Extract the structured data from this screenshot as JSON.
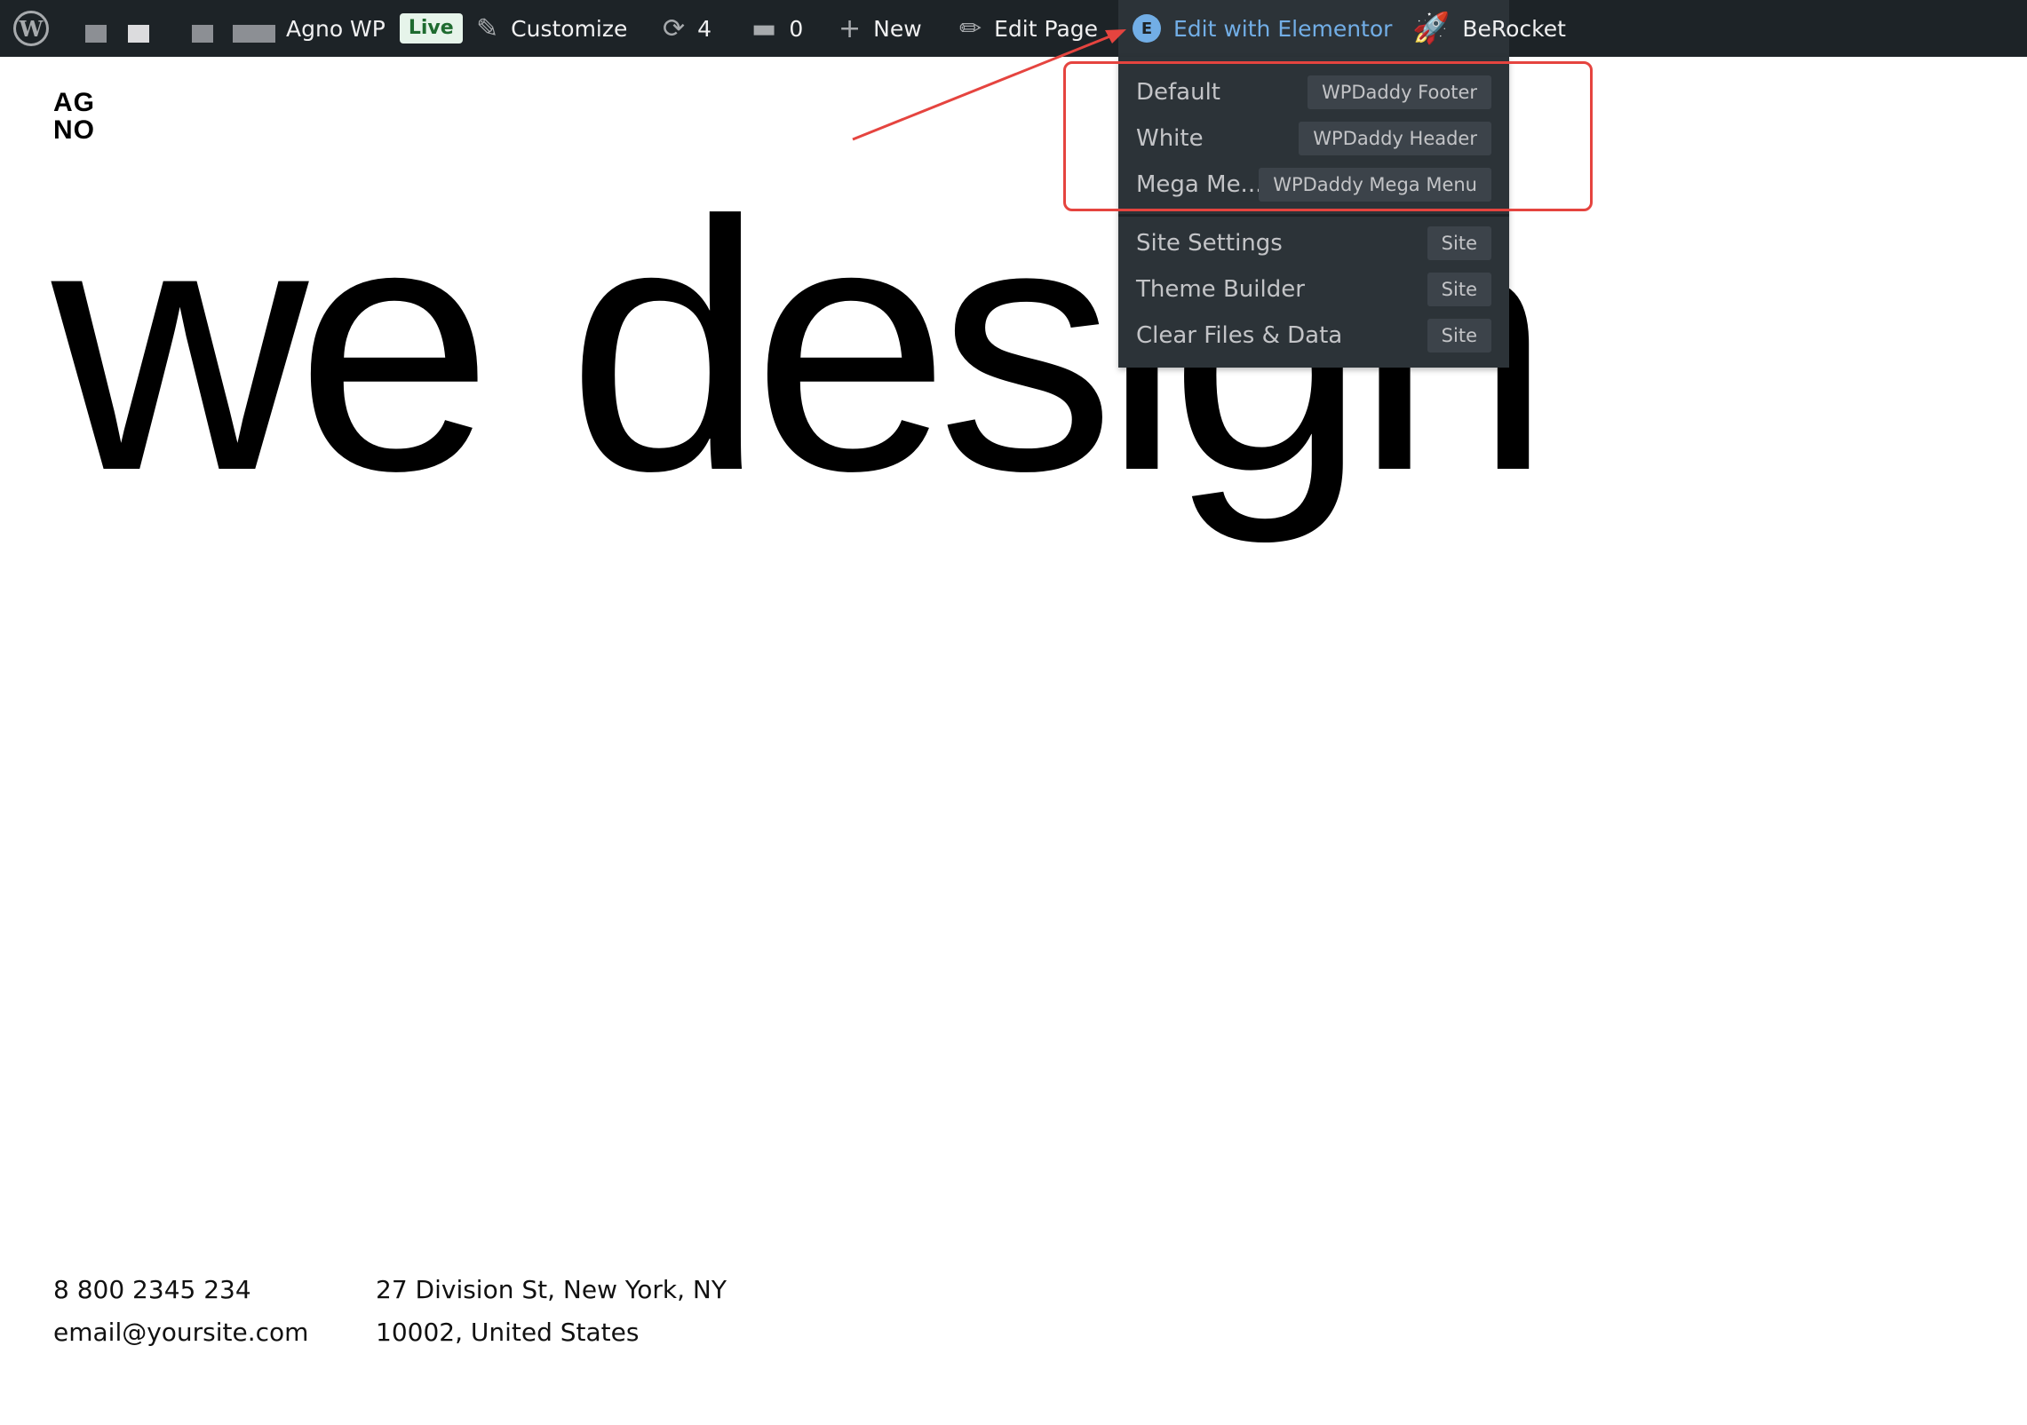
{
  "adminbar": {
    "site_name": "Agno WP",
    "live_badge": "Live",
    "customize": "Customize",
    "updates_count": "4",
    "comments_count": "0",
    "new_label": "New",
    "edit_page": "Edit Page",
    "elementor": "Edit with Elementor",
    "berocket": "BeRocket"
  },
  "dropdown": {
    "templates": [
      {
        "label": "Default",
        "badge": "WPDaddy Footer"
      },
      {
        "label": "White",
        "badge": "WPDaddy Header"
      },
      {
        "label": "Mega Me...",
        "badge": "WPDaddy Mega Menu"
      }
    ],
    "site": [
      {
        "label": "Site Settings",
        "badge": "Site"
      },
      {
        "label": "Theme Builder",
        "badge": "Site"
      },
      {
        "label": "Clear Files & Data",
        "badge": "Site"
      }
    ]
  },
  "page": {
    "logo_line1": "AG",
    "logo_line2": "NO",
    "hero": "we design",
    "footer": {
      "phone": "8 800 2345 234",
      "email": "email@yoursite.com",
      "address_line1": "27 Division St, New York, NY",
      "address_line2": "10002, United States"
    }
  },
  "colors": {
    "adminbar_bg": "#1d2327",
    "dropdown_bg": "#2c3338",
    "elementor_accent": "#72aee6",
    "annotation_red": "#e5443f",
    "live_badge_bg": "#e6f4ea"
  },
  "icons": [
    "wordpress-logo-icon",
    "brush-icon",
    "refresh-icon",
    "comment-icon",
    "plus-icon",
    "pencil-icon",
    "elementor-icon",
    "rocket-icon"
  ]
}
